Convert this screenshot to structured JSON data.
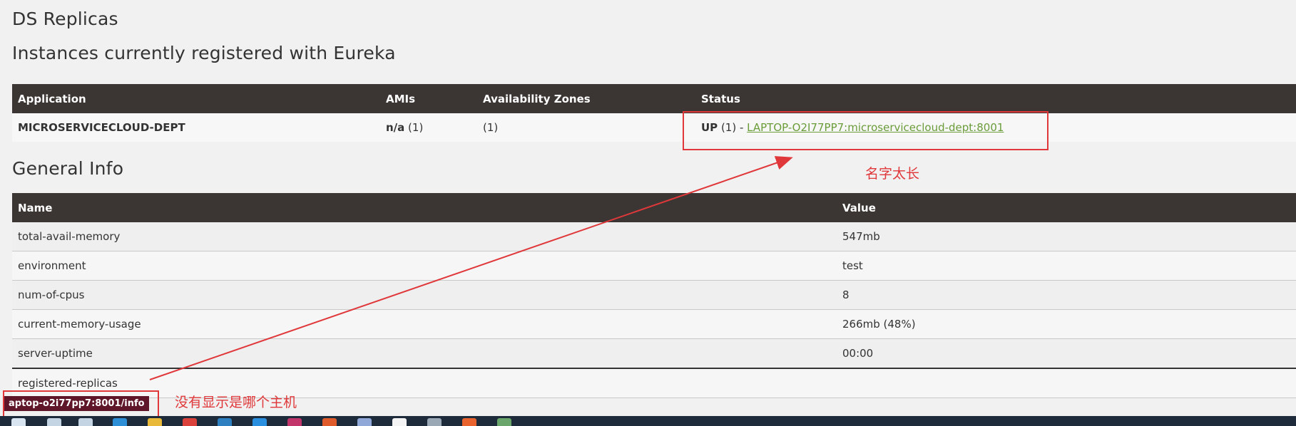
{
  "headings": {
    "ds_replicas": "DS Replicas",
    "instances": "Instances currently registered with Eureka",
    "general_info": "General Info"
  },
  "instances_table": {
    "headers": [
      "Application",
      "AMIs",
      "Availability Zones",
      "Status"
    ],
    "row": {
      "application": "MICROSERVICECLOUD-DEPT",
      "ami_bold": "n/a",
      "ami_count": " (1)",
      "zones": "(1)",
      "status_bold": "UP",
      "status_count": " (1) - ",
      "status_link": "LAPTOP-O2I77PP7:microservicecloud-dept:8001"
    }
  },
  "info_table": {
    "headers": [
      "Name",
      "Value"
    ],
    "rows": [
      {
        "name": "total-avail-memory",
        "value": "547mb"
      },
      {
        "name": "environment",
        "value": "test"
      },
      {
        "name": "num-of-cpus",
        "value": "8"
      },
      {
        "name": "current-memory-usage",
        "value": "266mb (48%)"
      },
      {
        "name": "server-uptime",
        "value": "00:00"
      },
      {
        "name": "registered-replicas",
        "value": ""
      }
    ]
  },
  "annotations": {
    "name_too_long": "名字太长",
    "no_host_shown": "没有显示是哪个主机",
    "color": "#e0383a"
  },
  "status_bar": {
    "url": "aptop-o2i77pp7:8001/info"
  },
  "colors": {
    "header_bg": "#3b3633",
    "link": "#6a9c3a",
    "page_bg": "#f1f1f1"
  }
}
